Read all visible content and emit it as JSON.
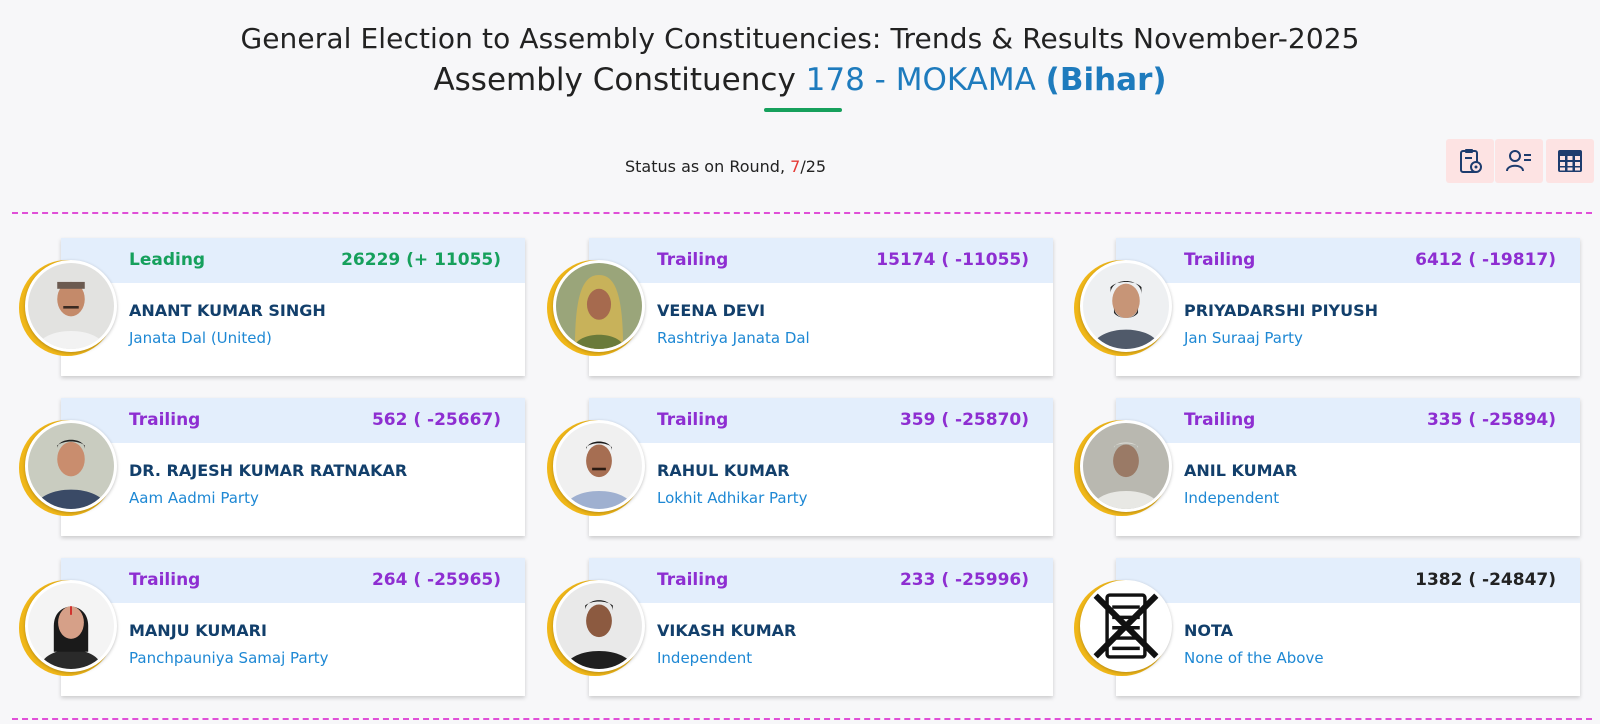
{
  "header": {
    "title_line1": "General Election to Assembly Constituencies: Trends & Results November-2025",
    "title_line2_prefix": "Assembly Constituency",
    "ac_number_name": "178 - MOKAMA",
    "state": "(Bihar)"
  },
  "status": {
    "label": "Status as on Round,",
    "current_round": "7",
    "separator": "/",
    "total_rounds": "25"
  },
  "toolbar": {
    "icons": [
      "clipboard-settings-icon",
      "user-list-icon",
      "table-grid-icon"
    ]
  },
  "colors": {
    "leading": "#16a05c",
    "trailing": "#8e2ed1",
    "card_band": "#e3eefc",
    "avatar_ring": "#f0b719",
    "divider": "#e04fd8",
    "candidate_name": "#123f6b",
    "party": "#1e88d4"
  },
  "candidates": [
    {
      "status": "Leading",
      "votes": "26229 (+ 11055)",
      "name": "ANANT KUMAR SINGH",
      "party": "Janata Dal (United)"
    },
    {
      "status": "Trailing",
      "votes": "15174 ( -11055)",
      "name": "VEENA DEVI",
      "party": "Rashtriya Janata Dal"
    },
    {
      "status": "Trailing",
      "votes": "6412 ( -19817)",
      "name": "PRIYADARSHI PIYUSH",
      "party": "Jan Suraaj Party"
    },
    {
      "status": "Trailing",
      "votes": "562 ( -25667)",
      "name": "DR. RAJESH KUMAR RATNAKAR",
      "party": "Aam Aadmi Party"
    },
    {
      "status": "Trailing",
      "votes": "359 ( -25870)",
      "name": "RAHUL KUMAR",
      "party": "Lokhit Adhikar Party"
    },
    {
      "status": "Trailing",
      "votes": "335 ( -25894)",
      "name": "ANIL KUMAR",
      "party": "Independent"
    },
    {
      "status": "Trailing",
      "votes": "264 ( -25965)",
      "name": "MANJU KUMARI",
      "party": "Panchpauniya Samaj Party"
    },
    {
      "status": "Trailing",
      "votes": "233 ( -25996)",
      "name": "VIKASH KUMAR",
      "party": "Independent"
    },
    {
      "status": "",
      "votes": "1382 ( -24847)",
      "name": "NOTA",
      "party": "None of the Above"
    }
  ]
}
